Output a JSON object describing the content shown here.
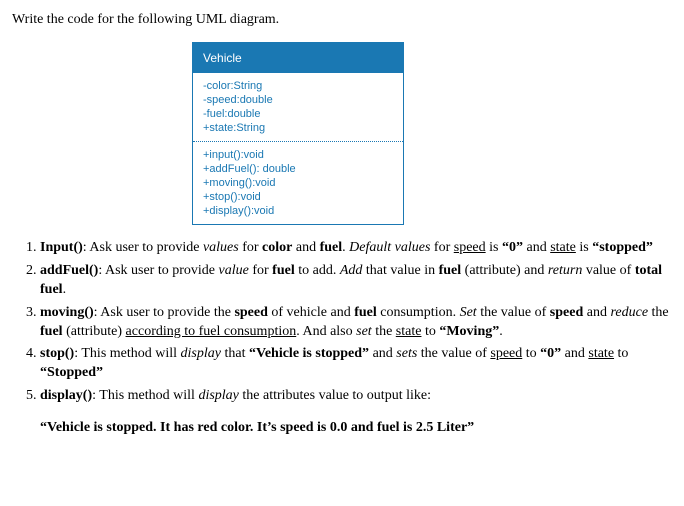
{
  "prompt": "Write the code for the following UML diagram.",
  "uml": {
    "title": "Vehicle",
    "attrs": [
      "-color:String",
      "-speed:double",
      "-fuel:double",
      "+state:String"
    ],
    "ops": [
      "+input():void",
      "+addFuel(): double",
      "+moving():void",
      "+stop():void",
      "+display():void"
    ]
  },
  "items": [
    {
      "title": "Input()",
      "seg": [
        {
          "t": ": Ask user to provide "
        },
        {
          "t": "values",
          "i": true
        },
        {
          "t": " for "
        },
        {
          "t": "color",
          "b": true
        },
        {
          "t": " and "
        },
        {
          "t": "fuel",
          "b": true
        },
        {
          "t": ". "
        },
        {
          "t": "Default values",
          "i": true
        },
        {
          "t": " for "
        },
        {
          "t": "speed",
          "u": true
        },
        {
          "t": " is "
        },
        {
          "t": "“0”",
          "b": true
        },
        {
          "t": " and "
        },
        {
          "t": "state",
          "u": true
        },
        {
          "t": " is "
        },
        {
          "t": "“stopped”",
          "b": true
        }
      ]
    },
    {
      "title": "addFuel()",
      "seg": [
        {
          "t": ": Ask user to provide "
        },
        {
          "t": "value",
          "i": true
        },
        {
          "t": " for "
        },
        {
          "t": "fuel",
          "b": true
        },
        {
          "t": " to add. "
        },
        {
          "t": "Add",
          "i": true
        },
        {
          "t": " that value in "
        },
        {
          "t": "fuel",
          "b": true
        },
        {
          "t": " (attribute) and "
        },
        {
          "t": "return",
          "i": true
        },
        {
          "t": " value of "
        },
        {
          "t": "total fuel",
          "b": true
        },
        {
          "t": "."
        }
      ]
    },
    {
      "title": "moving()",
      "seg": [
        {
          "t": ": Ask user to provide the "
        },
        {
          "t": "speed",
          "b": true
        },
        {
          "t": " of vehicle and "
        },
        {
          "t": "fuel",
          "b": true
        },
        {
          "t": " consumption. "
        },
        {
          "t": "Set",
          "i": true
        },
        {
          "t": " the value of "
        },
        {
          "t": "speed",
          "b": true
        },
        {
          "t": " and "
        },
        {
          "t": "reduce",
          "i": true
        },
        {
          "t": " the "
        },
        {
          "t": "fuel",
          "b": true
        },
        {
          "t": " (attribute) "
        },
        {
          "t": "according to fuel consumption",
          "u": true
        },
        {
          "t": ". And also "
        },
        {
          "t": "set",
          "i": true
        },
        {
          "t": " the "
        },
        {
          "t": "state",
          "u": true
        },
        {
          "t": " to "
        },
        {
          "t": "“Moving”",
          "b": true
        },
        {
          "t": "."
        }
      ]
    },
    {
      "title": "stop()",
      "seg": [
        {
          "t": ": This method will "
        },
        {
          "t": "display",
          "i": true
        },
        {
          "t": " that "
        },
        {
          "t": "“Vehicle is stopped”",
          "b": true
        },
        {
          "t": " and "
        },
        {
          "t": "sets",
          "i": true
        },
        {
          "t": " the value of "
        },
        {
          "t": "speed",
          "u": true
        },
        {
          "t": " to "
        },
        {
          "t": "“0”",
          "b": true
        },
        {
          "t": " and "
        },
        {
          "t": "state",
          "u": true
        },
        {
          "t": " to "
        },
        {
          "t": "“Stopped”",
          "b": true
        }
      ]
    },
    {
      "title": "display()",
      "seg": [
        {
          "t": ": This method will "
        },
        {
          "t": "display",
          "i": true
        },
        {
          "t": " the attributes value to output like:"
        }
      ]
    }
  ],
  "sample_output": "“Vehicle is stopped. It has red color. It’s speed is 0.0 and fuel is 2.5 Liter”"
}
